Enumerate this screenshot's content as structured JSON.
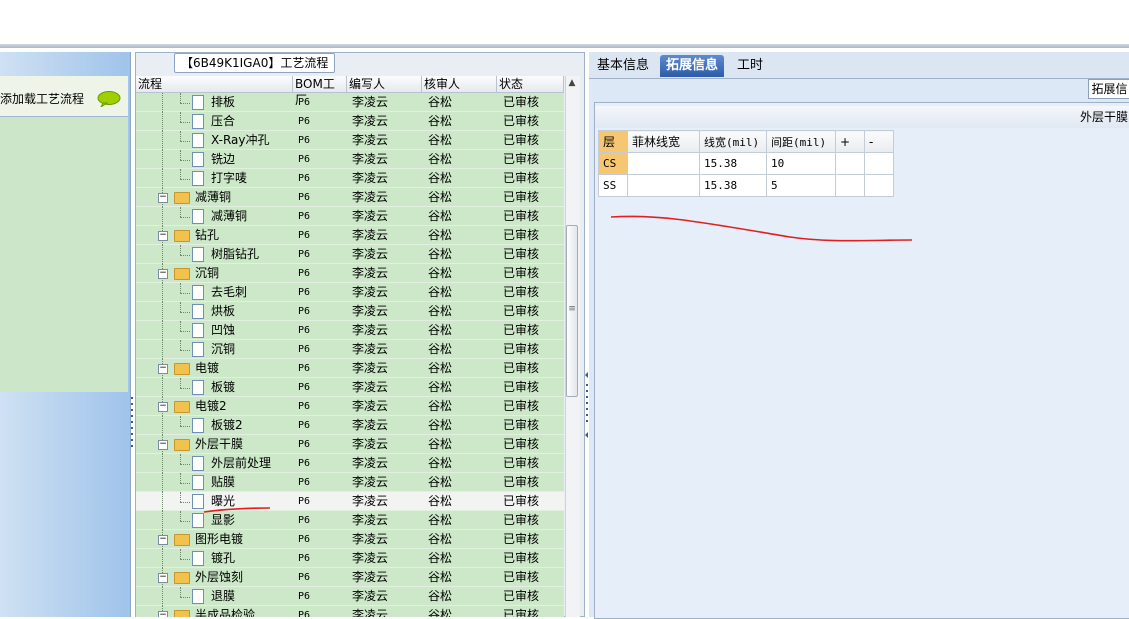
{
  "left_panel": {
    "label": "添加载工艺流程"
  },
  "flow_panel": {
    "title": "【6B49K1IGA0】工艺流程",
    "columns": [
      "流程",
      "BOM工厂",
      "编写人",
      "核审人",
      "状态"
    ],
    "rows": [
      {
        "level": 2,
        "kind": "doc",
        "name": "排板",
        "factory": "P6",
        "writer": "李凌云",
        "reviewer": "谷松",
        "status": "已审核"
      },
      {
        "level": 2,
        "kind": "doc",
        "name": "压合",
        "factory": "P6",
        "writer": "李凌云",
        "reviewer": "谷松",
        "status": "已审核"
      },
      {
        "level": 2,
        "kind": "doc",
        "name": "X-Ray冲孔",
        "factory": "P6",
        "writer": "李凌云",
        "reviewer": "谷松",
        "status": "已审核"
      },
      {
        "level": 2,
        "kind": "doc",
        "name": "铣边",
        "factory": "P6",
        "writer": "李凌云",
        "reviewer": "谷松",
        "status": "已审核"
      },
      {
        "level": 2,
        "kind": "doc",
        "name": "打字唛",
        "factory": "P6",
        "writer": "李凌云",
        "reviewer": "谷松",
        "status": "已审核"
      },
      {
        "level": 1,
        "kind": "folder",
        "name": "减薄铜",
        "factory": "P6",
        "writer": "李凌云",
        "reviewer": "谷松",
        "status": "已审核"
      },
      {
        "level": 2,
        "kind": "doc",
        "name": "减薄铜",
        "factory": "P6",
        "writer": "李凌云",
        "reviewer": "谷松",
        "status": "已审核"
      },
      {
        "level": 1,
        "kind": "folder",
        "name": "钻孔",
        "factory": "P6",
        "writer": "李凌云",
        "reviewer": "谷松",
        "status": "已审核"
      },
      {
        "level": 2,
        "kind": "doc",
        "name": "树脂钻孔",
        "factory": "P6",
        "writer": "李凌云",
        "reviewer": "谷松",
        "status": "已审核"
      },
      {
        "level": 1,
        "kind": "folder",
        "name": "沉铜",
        "factory": "P6",
        "writer": "李凌云",
        "reviewer": "谷松",
        "status": "已审核"
      },
      {
        "level": 2,
        "kind": "doc",
        "name": "去毛刺",
        "factory": "P6",
        "writer": "李凌云",
        "reviewer": "谷松",
        "status": "已审核"
      },
      {
        "level": 2,
        "kind": "doc",
        "name": "烘板",
        "factory": "P6",
        "writer": "李凌云",
        "reviewer": "谷松",
        "status": "已审核"
      },
      {
        "level": 2,
        "kind": "doc",
        "name": "凹蚀",
        "factory": "P6",
        "writer": "李凌云",
        "reviewer": "谷松",
        "status": "已审核"
      },
      {
        "level": 2,
        "kind": "doc",
        "name": "沉铜",
        "factory": "P6",
        "writer": "李凌云",
        "reviewer": "谷松",
        "status": "已审核"
      },
      {
        "level": 1,
        "kind": "folder",
        "name": "电镀",
        "factory": "P6",
        "writer": "李凌云",
        "reviewer": "谷松",
        "status": "已审核"
      },
      {
        "level": 2,
        "kind": "doc",
        "name": "板镀",
        "factory": "P6",
        "writer": "李凌云",
        "reviewer": "谷松",
        "status": "已审核"
      },
      {
        "level": 1,
        "kind": "folder",
        "name": "电镀2",
        "factory": "P6",
        "writer": "李凌云",
        "reviewer": "谷松",
        "status": "已审核"
      },
      {
        "level": 2,
        "kind": "doc",
        "name": "板镀2",
        "factory": "P6",
        "writer": "李凌云",
        "reviewer": "谷松",
        "status": "已审核"
      },
      {
        "level": 1,
        "kind": "folder",
        "name": "外层干膜",
        "factory": "P6",
        "writer": "李凌云",
        "reviewer": "谷松",
        "status": "已审核"
      },
      {
        "level": 2,
        "kind": "doc",
        "name": "外层前处理",
        "factory": "P6",
        "writer": "李凌云",
        "reviewer": "谷松",
        "status": "已审核"
      },
      {
        "level": 2,
        "kind": "doc",
        "name": "贴膜",
        "factory": "P6",
        "writer": "李凌云",
        "reviewer": "谷松",
        "status": "已审核"
      },
      {
        "level": 2,
        "kind": "doc",
        "name": "曝光",
        "factory": "P6",
        "writer": "李凌云",
        "reviewer": "谷松",
        "status": "已审核",
        "selected": true
      },
      {
        "level": 2,
        "kind": "doc",
        "name": "显影",
        "factory": "P6",
        "writer": "李凌云",
        "reviewer": "谷松",
        "status": "已审核"
      },
      {
        "level": 1,
        "kind": "folder",
        "name": "图形电镀",
        "factory": "P6",
        "writer": "李凌云",
        "reviewer": "谷松",
        "status": "已审核"
      },
      {
        "level": 2,
        "kind": "doc",
        "name": "镀孔",
        "factory": "P6",
        "writer": "李凌云",
        "reviewer": "谷松",
        "status": "已审核"
      },
      {
        "level": 1,
        "kind": "folder",
        "name": "外层蚀刻",
        "factory": "P6",
        "writer": "李凌云",
        "reviewer": "谷松",
        "status": "已审核"
      },
      {
        "level": 2,
        "kind": "doc",
        "name": "退膜",
        "factory": "P6",
        "writer": "李凌云",
        "reviewer": "谷松",
        "status": "已审核"
      },
      {
        "level": 1,
        "kind": "folder",
        "name": "半成品检验",
        "factory": "P6",
        "writer": "李凌云",
        "reviewer": "谷松",
        "status": "已审核"
      }
    ]
  },
  "right_panel": {
    "tabs": [
      {
        "label": "基本信息",
        "active": false
      },
      {
        "label": "拓展信息",
        "active": true
      },
      {
        "label": "工时",
        "active": false
      }
    ],
    "ext_button": "拓展信",
    "inner_title": "外层干膜",
    "table": {
      "headers": [
        "层",
        "菲林线宽",
        "线宽(mil)",
        "间距(mil)",
        "+",
        "-"
      ],
      "rows": [
        {
          "layer": "CS",
          "film": "",
          "width": "15.38",
          "spacing": "10"
        },
        {
          "layer": "SS",
          "film": "",
          "width": "15.38",
          "spacing": "5"
        }
      ]
    }
  },
  "annotation_color": "#e02020",
  "colors": {
    "grid_bg": "#cce8c8",
    "tab_active": "#2d5da8",
    "layer_highlight": "#f6c770"
  }
}
